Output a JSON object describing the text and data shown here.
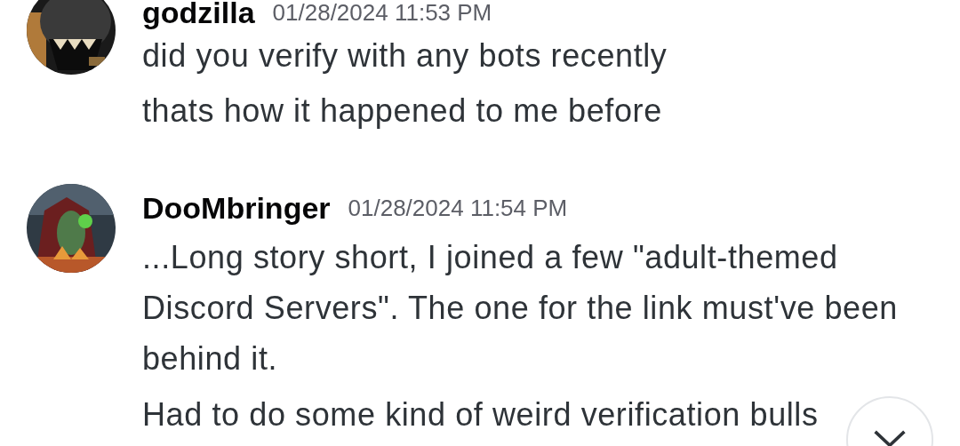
{
  "messages": [
    {
      "author": "godzilla",
      "timestamp": "01/28/2024 11:53 PM",
      "lines": [
        "did you verify with any bots recently",
        "thats how it happened to me before"
      ]
    },
    {
      "author": "DooMbringer",
      "timestamp": "01/28/2024 11:54 PM",
      "lines": [
        "...Long story short, I joined a few \"adult-themed Discord Servers\". The one for the link must've been behind it.",
        "Had to do some kind of weird verification bulls"
      ]
    }
  ]
}
